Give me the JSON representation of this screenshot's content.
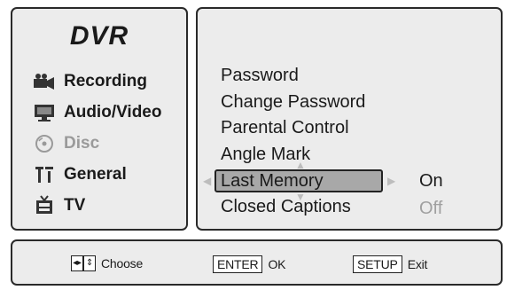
{
  "sidebar": {
    "title": "DVR",
    "items": [
      {
        "label": "Recording",
        "icon": "camcorder-icon",
        "enabled": true
      },
      {
        "label": "Audio/Video",
        "icon": "monitor-icon",
        "enabled": true
      },
      {
        "label": "Disc",
        "icon": "disc-icon",
        "enabled": false
      },
      {
        "label": "General",
        "icon": "general-icon",
        "enabled": true
      },
      {
        "label": "TV",
        "icon": "tv-icon",
        "enabled": true
      }
    ]
  },
  "menu": {
    "items": [
      {
        "label": "Password",
        "value": ""
      },
      {
        "label": "Change Password",
        "value": ""
      },
      {
        "label": "Parental Control",
        "value": ""
      },
      {
        "label": "Angle Mark",
        "value": ""
      },
      {
        "label": "Last Memory",
        "value": "On",
        "selected": true
      },
      {
        "label": "Closed Captions",
        "value": "Off",
        "value_dimmed": true
      }
    ]
  },
  "footer": {
    "choose_label": "Choose",
    "enter_key": "ENTER",
    "ok_label": "OK",
    "setup_key": "SETUP",
    "exit_label": "Exit"
  }
}
